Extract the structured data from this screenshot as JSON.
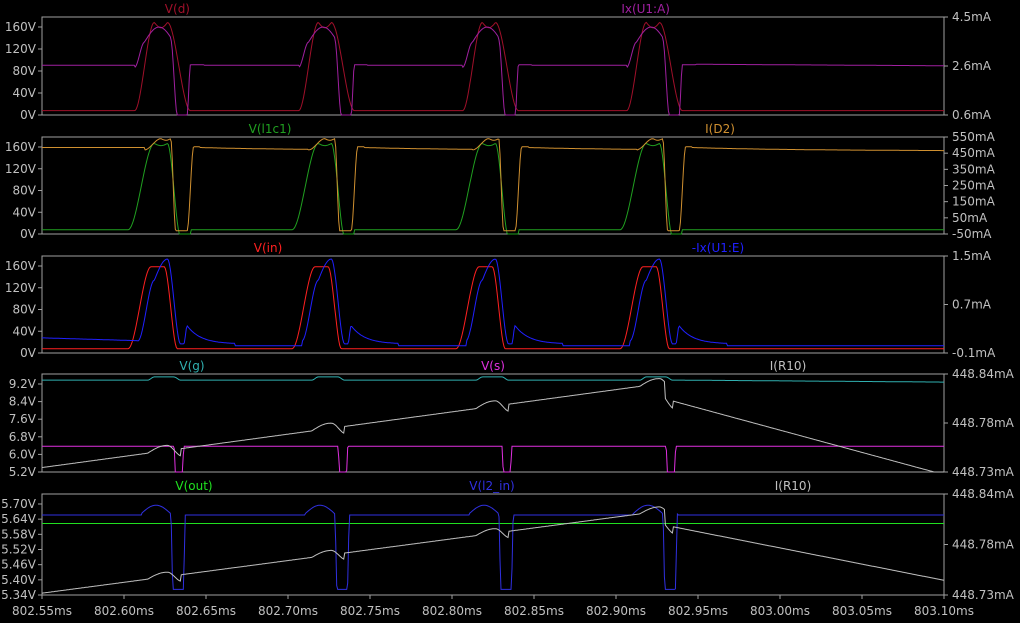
{
  "window": {
    "background": "#000000",
    "frame_color": "#a0a0a0",
    "text_color": "#c0c0c0"
  },
  "x_axis": {
    "range": [
      802.55,
      803.1
    ],
    "unit": "ms",
    "tick_labels": [
      "802.55ms",
      "802.60ms",
      "802.65ms",
      "802.70ms",
      "802.75ms",
      "802.80ms",
      "802.85ms",
      "802.90ms",
      "802.95ms",
      "803.00ms",
      "803.05ms",
      "803.10ms"
    ]
  },
  "chart_data": [
    {
      "type": "line",
      "left_axis": {
        "range": [
          0,
          180
        ],
        "tick_labels": [
          "160V",
          "120V",
          "80V",
          "40V",
          "0V"
        ]
      },
      "right_axis": {
        "range": [
          0.6,
          4.5
        ],
        "tick_labels": [
          "4.5mA",
          "2.6mA",
          "0.6mA"
        ]
      },
      "series": [
        {
          "name": "V(d)",
          "color": "#a0102a",
          "axis": "left"
        },
        {
          "name": "Ix(U1:A)",
          "color": "#a020a0",
          "axis": "right"
        }
      ]
    },
    {
      "type": "line",
      "left_axis": {
        "range": [
          0,
          180
        ],
        "tick_labels": [
          "160V",
          "120V",
          "80V",
          "40V",
          "0V"
        ]
      },
      "right_axis": {
        "range": [
          -50,
          550
        ],
        "tick_labels": [
          "550mA",
          "450mA",
          "350mA",
          "250mA",
          "150mA",
          "50mA",
          "-50mA"
        ]
      },
      "series": [
        {
          "name": "V(l1c1)",
          "color": "#20a020",
          "axis": "left"
        },
        {
          "name": "I(D2)",
          "color": "#d09030",
          "axis": "right"
        }
      ]
    },
    {
      "type": "line",
      "left_axis": {
        "range": [
          0,
          180
        ],
        "tick_labels": [
          "160V",
          "120V",
          "80V",
          "40V",
          "0V"
        ]
      },
      "right_axis": {
        "range": [
          -0.1,
          1.5
        ],
        "tick_labels": [
          "1.5mA",
          "0.7mA",
          "-0.1mA"
        ]
      },
      "series": [
        {
          "name": "V(in)",
          "color": "#ff2020",
          "axis": "left"
        },
        {
          "name": "-Ix(U1:E)",
          "color": "#2020ff",
          "axis": "right"
        }
      ]
    },
    {
      "type": "line",
      "left_axis": {
        "range": [
          5.2,
          9.2
        ],
        "tick_labels": [
          "9.2V",
          "8.4V",
          "7.6V",
          "6.8V",
          "6.0V",
          "5.2V"
        ]
      },
      "right_axis": {
        "range": [
          448.73,
          448.84
        ],
        "tick_labels": [
          "448.84mA",
          "448.78mA",
          "448.73mA"
        ]
      },
      "series": [
        {
          "name": "V(g)",
          "color": "#30b0b0",
          "axis": "left"
        },
        {
          "name": "V(s)",
          "color": "#e030e0",
          "axis": "left"
        },
        {
          "name": "I(R10)",
          "color": "#c0c0c0",
          "axis": "right"
        }
      ]
    },
    {
      "type": "line",
      "left_axis": {
        "range": [
          5.34,
          5.7
        ],
        "tick_labels": [
          "5.70V",
          "5.64V",
          "5.58V",
          "5.52V",
          "5.46V",
          "5.40V",
          "5.34V"
        ]
      },
      "right_axis": {
        "range": [
          448.73,
          448.84
        ],
        "tick_labels": [
          "448.84mA",
          "448.78mA",
          "448.73mA"
        ]
      },
      "series": [
        {
          "name": "V(out)",
          "color": "#20e020",
          "axis": "left"
        },
        {
          "name": "V(l2_in)",
          "color": "#3030e0",
          "axis": "left"
        },
        {
          "name": "I(R10)",
          "color": "#c0c0c0",
          "axis": "right"
        }
      ]
    }
  ]
}
